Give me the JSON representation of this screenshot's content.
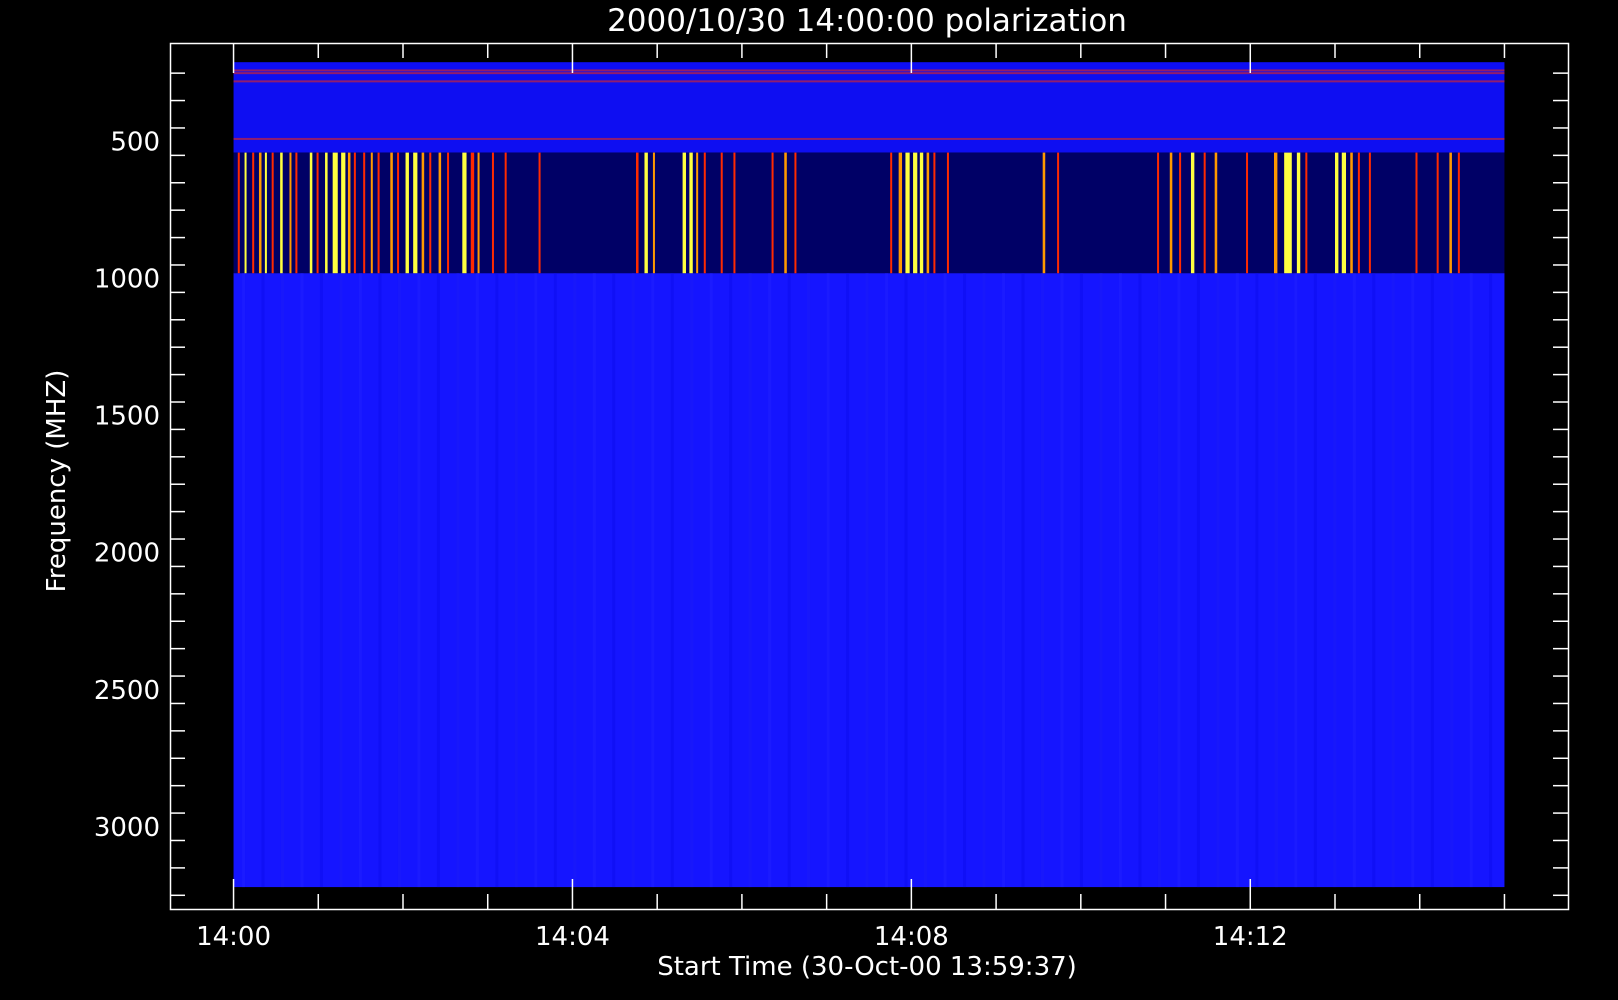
{
  "chart_data": {
    "type": "heatmap",
    "title": "2000/10/30 14:00:00 polarization",
    "xlabel": "Start Time (30-Oct-00 13:59:37)",
    "ylabel": "Frequency (MHZ)",
    "x_ticks": [
      "14:00",
      "14:04",
      "14:08",
      "14:12"
    ],
    "x_tick_minutes": [
      0,
      4,
      8,
      12
    ],
    "y_ticks": [
      500,
      1000,
      1500,
      2000,
      2500,
      3000
    ],
    "xlim_minutes": [
      -0.75,
      15.75
    ],
    "ylim": [
      3300,
      140
    ],
    "data_extent": {
      "x_minutes": [
        0,
        15
      ],
      "low_band_mhz": [
        210,
        540
      ],
      "mid_band_mhz": [
        540,
        980
      ],
      "high_band_mhz": [
        980,
        3220
      ]
    },
    "grid": false,
    "colors": {
      "background": "#000000",
      "axis": "#ffffff",
      "low_band": "#0e0ef2",
      "mid_band_background": "#000066",
      "high_band": "#1515ff",
      "burst_red": "#ff2a00",
      "burst_orange": "#ff9900",
      "burst_yellow": "#ffff40"
    },
    "mid_band_stripes": [
      {
        "t": 0.05,
        "w": 0.02,
        "level": "red"
      },
      {
        "t": 0.13,
        "w": 0.02,
        "level": "yellow"
      },
      {
        "t": 0.22,
        "w": 0.02,
        "level": "red"
      },
      {
        "t": 0.3,
        "w": 0.03,
        "level": "orange"
      },
      {
        "t": 0.37,
        "w": 0.02,
        "level": "yellow"
      },
      {
        "t": 0.45,
        "w": 0.02,
        "level": "red"
      },
      {
        "t": 0.55,
        "w": 0.03,
        "level": "yellow"
      },
      {
        "t": 0.66,
        "w": 0.02,
        "level": "orange"
      },
      {
        "t": 0.73,
        "w": 0.02,
        "level": "red"
      },
      {
        "t": 0.9,
        "w": 0.03,
        "level": "yellow"
      },
      {
        "t": 0.98,
        "w": 0.02,
        "level": "red"
      },
      {
        "t": 1.08,
        "w": 0.03,
        "level": "yellow"
      },
      {
        "t": 1.17,
        "w": 0.06,
        "level": "yellow"
      },
      {
        "t": 1.27,
        "w": 0.05,
        "level": "yellow"
      },
      {
        "t": 1.35,
        "w": 0.03,
        "level": "orange"
      },
      {
        "t": 1.42,
        "w": 0.02,
        "level": "red"
      },
      {
        "t": 1.53,
        "w": 0.02,
        "level": "red"
      },
      {
        "t": 1.62,
        "w": 0.02,
        "level": "orange"
      },
      {
        "t": 1.7,
        "w": 0.02,
        "level": "red"
      },
      {
        "t": 1.85,
        "w": 0.03,
        "level": "orange"
      },
      {
        "t": 1.93,
        "w": 0.02,
        "level": "red"
      },
      {
        "t": 2.03,
        "w": 0.04,
        "level": "yellow"
      },
      {
        "t": 2.12,
        "w": 0.05,
        "level": "yellow"
      },
      {
        "t": 2.22,
        "w": 0.03,
        "level": "orange"
      },
      {
        "t": 2.31,
        "w": 0.02,
        "level": "red"
      },
      {
        "t": 2.42,
        "w": 0.03,
        "level": "orange"
      },
      {
        "t": 2.52,
        "w": 0.02,
        "level": "red"
      },
      {
        "t": 2.7,
        "w": 0.05,
        "level": "yellow"
      },
      {
        "t": 2.8,
        "w": 0.04,
        "level": "red"
      },
      {
        "t": 2.88,
        "w": 0.02,
        "level": "orange"
      },
      {
        "t": 3.05,
        "w": 0.02,
        "level": "red"
      },
      {
        "t": 3.2,
        "w": 0.02,
        "level": "red"
      },
      {
        "t": 3.6,
        "w": 0.02,
        "level": "red"
      },
      {
        "t": 4.75,
        "w": 0.03,
        "level": "red"
      },
      {
        "t": 4.85,
        "w": 0.04,
        "level": "yellow"
      },
      {
        "t": 4.95,
        "w": 0.02,
        "level": "orange"
      },
      {
        "t": 5.3,
        "w": 0.04,
        "level": "yellow"
      },
      {
        "t": 5.38,
        "w": 0.04,
        "level": "yellow"
      },
      {
        "t": 5.46,
        "w": 0.02,
        "level": "orange"
      },
      {
        "t": 5.55,
        "w": 0.02,
        "level": "red"
      },
      {
        "t": 5.75,
        "w": 0.02,
        "level": "red"
      },
      {
        "t": 5.9,
        "w": 0.02,
        "level": "red"
      },
      {
        "t": 6.35,
        "w": 0.02,
        "level": "red"
      },
      {
        "t": 6.5,
        "w": 0.03,
        "level": "orange"
      },
      {
        "t": 6.62,
        "w": 0.02,
        "level": "red"
      },
      {
        "t": 7.75,
        "w": 0.02,
        "level": "red"
      },
      {
        "t": 7.85,
        "w": 0.04,
        "level": "orange"
      },
      {
        "t": 7.93,
        "w": 0.05,
        "level": "yellow"
      },
      {
        "t": 8.02,
        "w": 0.05,
        "level": "yellow"
      },
      {
        "t": 8.1,
        "w": 0.04,
        "level": "yellow"
      },
      {
        "t": 8.18,
        "w": 0.03,
        "level": "orange"
      },
      {
        "t": 8.26,
        "w": 0.02,
        "level": "red"
      },
      {
        "t": 8.42,
        "w": 0.02,
        "level": "red"
      },
      {
        "t": 9.55,
        "w": 0.03,
        "level": "orange"
      },
      {
        "t": 9.72,
        "w": 0.02,
        "level": "red"
      },
      {
        "t": 10.9,
        "w": 0.02,
        "level": "red"
      },
      {
        "t": 11.05,
        "w": 0.03,
        "level": "orange"
      },
      {
        "t": 11.16,
        "w": 0.02,
        "level": "red"
      },
      {
        "t": 11.3,
        "w": 0.04,
        "level": "yellow"
      },
      {
        "t": 11.45,
        "w": 0.02,
        "level": "red"
      },
      {
        "t": 11.58,
        "w": 0.03,
        "level": "orange"
      },
      {
        "t": 11.95,
        "w": 0.02,
        "level": "red"
      },
      {
        "t": 12.28,
        "w": 0.04,
        "level": "orange"
      },
      {
        "t": 12.4,
        "w": 0.09,
        "level": "yellow"
      },
      {
        "t": 12.55,
        "w": 0.04,
        "level": "yellow"
      },
      {
        "t": 12.65,
        "w": 0.02,
        "level": "red"
      },
      {
        "t": 13.0,
        "w": 0.04,
        "level": "yellow"
      },
      {
        "t": 13.08,
        "w": 0.05,
        "level": "yellow"
      },
      {
        "t": 13.18,
        "w": 0.03,
        "level": "orange"
      },
      {
        "t": 13.27,
        "w": 0.02,
        "level": "red"
      },
      {
        "t": 13.4,
        "w": 0.02,
        "level": "red"
      },
      {
        "t": 13.95,
        "w": 0.02,
        "level": "red"
      },
      {
        "t": 14.2,
        "w": 0.02,
        "level": "red"
      },
      {
        "t": 14.35,
        "w": 0.03,
        "level": "orange"
      },
      {
        "t": 14.45,
        "w": 0.02,
        "level": "red"
      }
    ],
    "low_band_red_lines_mhz": [
      240,
      250,
      280,
      490
    ]
  }
}
